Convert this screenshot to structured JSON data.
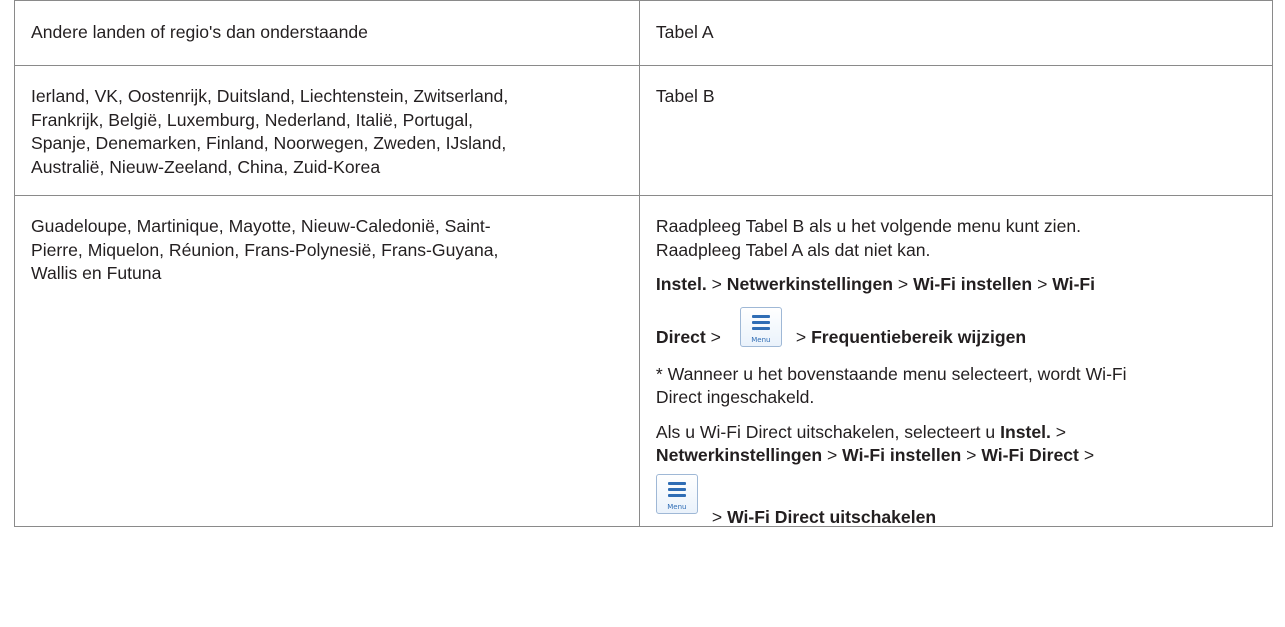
{
  "rows": [
    {
      "region": "Andere landen of regio's dan onderstaande",
      "table": "Tabel A"
    },
    {
      "region_lines": [
        "Ierland, VK, Oostenrijk, Duitsland, Liechtenstein, Zwitserland,",
        "Frankrijk, België, Luxemburg, Nederland, Italië, Portugal,",
        "Spanje, Denemarken, Finland, Noorwegen, Zweden, IJsland,",
        "Australië, Nieuw-Zeeland, China, Zuid-Korea"
      ],
      "table": "Tabel B"
    },
    {
      "region_lines": [
        "Guadeloupe, Martinique, Mayotte, Nieuw-Caledonië, Saint-",
        "Pierre, Miquelon, Réunion, Frans-Polynesië, Frans-Guyana,",
        "Wallis en Futuna"
      ],
      "intro_lines": [
        "Raadpleeg Tabel B als u het volgende menu kunt zien.",
        "Raadpleeg Tabel A als dat niet kan."
      ],
      "path1": {
        "instel": "Instel.",
        "sep": ">",
        "netwerk": "Netwerkinstellingen",
        "wifi_instellen": "Wi-Fi instellen",
        "wifi": "Wi-Fi",
        "direct": "Direct",
        "frequentie": "Frequentiebereik wijzigen"
      },
      "note_lines": [
        "* Wanneer u het bovenstaande menu selecteert, wordt Wi-Fi",
        "Direct ingeschakeld."
      ],
      "disable": {
        "text_prefix": "Als u Wi-Fi Direct uitschakelen, selecteert u",
        "instel": "Instel.",
        "sep": ">",
        "netwerk": "Netwerkinstellingen",
        "wifi_instellen": "Wi-Fi instellen",
        "wifi_direct": "Wi-Fi Direct",
        "uitschakelen": "Wi-Fi Direct uitschakelen"
      }
    }
  ],
  "menu_icon": {
    "name": "menu-icon",
    "label": "Menu"
  }
}
